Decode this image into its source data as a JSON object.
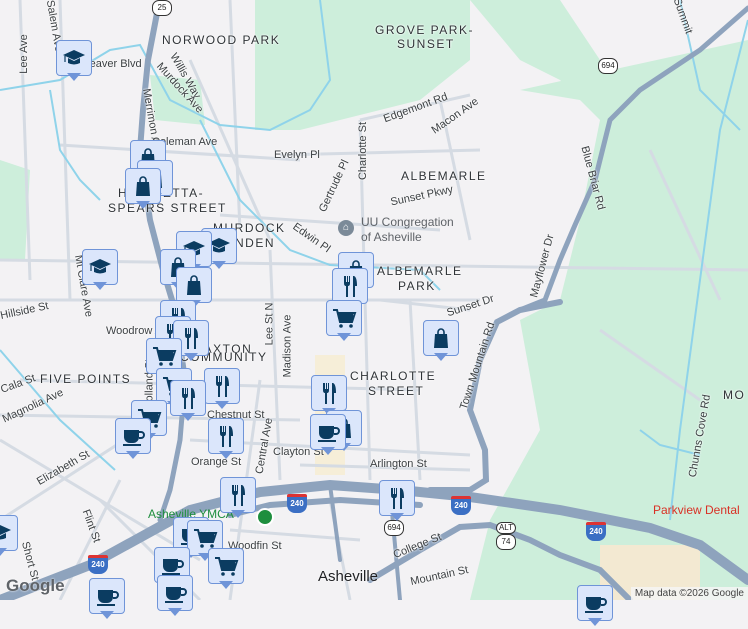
{
  "neighborhoods": {
    "norwood_park": "NORWOOD PARK",
    "grove_park_1": "GROVE PARK-",
    "grove_park_2": "SUNSET",
    "albemarle": "ALBEMARLE",
    "albemarle_park_1": "ALBEMARLE",
    "albemarle_park_2": "PARK",
    "henrietta_1": "HENRIETTA-",
    "henrietta_2": "SPEARS STREET",
    "murdock_1": "MURDOCK",
    "murdock_2": "LINDEN",
    "paxton_1": "PAXTON",
    "paxton_2": "COMMUNITY",
    "five_points": "FIVE POINTS",
    "charlotte_1": "CHARLOTTE",
    "charlotte_2": "STREET",
    "mo": "MO"
  },
  "streets": {
    "lee": "Lee Ave",
    "salem": "Salem Ave",
    "weaver": "W Weaver Blvd",
    "merrimon": "Merrimon Ave",
    "willis": "Willis Way",
    "murdock": "Murdock Ave",
    "coleman": "Coleman Ave",
    "evelyn": "Evelyn Pl",
    "charlotte": "Charlotte St",
    "gertrude": "Gertrude Pl",
    "edwin": "Edwin Pl",
    "edgemont": "Edgemont Rd",
    "macon": "Macon Ave",
    "sunset_pkwy": "Sunset Pkwy",
    "sunset_dr": "Sunset Dr",
    "blue_briar": "Blue Briar Rd",
    "mayflower": "Mayflower Dr",
    "town_mountain": "Town Mountain Rd",
    "mt_clare": "Mt Clare Ave",
    "hillside": "Hillside St",
    "woodrow": "Woodrow Ave",
    "lee_st": "Lee St N",
    "madison": "Madison Ave",
    "chestnut": "Chestnut St",
    "holland": "Holland St",
    "central": "Central Ave",
    "clayton": "Clayton St",
    "orange": "Orange St",
    "arlington": "Arlington St",
    "elizabeth": "Elizabeth St",
    "magnolia": "Magnolia Ave",
    "cala": "Cala St",
    "flint": "Flint St",
    "short": "Short St",
    "woodfin": "Woodfin St",
    "college": "College St",
    "mountain": "Mountain St",
    "chunns_cove": "Chunns Cove Rd",
    "summit": "Summit"
  },
  "places": {
    "uu_1": "UU Congregation",
    "uu_2": "of Asheville",
    "ymca": "Asheville YMCA",
    "parkview": "Parkview Dental",
    "asheville": "Asheville"
  },
  "shields": {
    "us25": "25",
    "i240": "240",
    "nc694": "694",
    "alt": "ALT",
    "us74": "74"
  },
  "footer": {
    "logo": "Google",
    "attribution": "Map data ©2026 Google"
  },
  "colors": {
    "background": "#f3f2f4",
    "park": "#cdeedb",
    "highway": "#8ea3bd",
    "water": "#8fd3ea",
    "marker_fill": "#dbe6fb",
    "marker_icon": "#0b3c61"
  }
}
